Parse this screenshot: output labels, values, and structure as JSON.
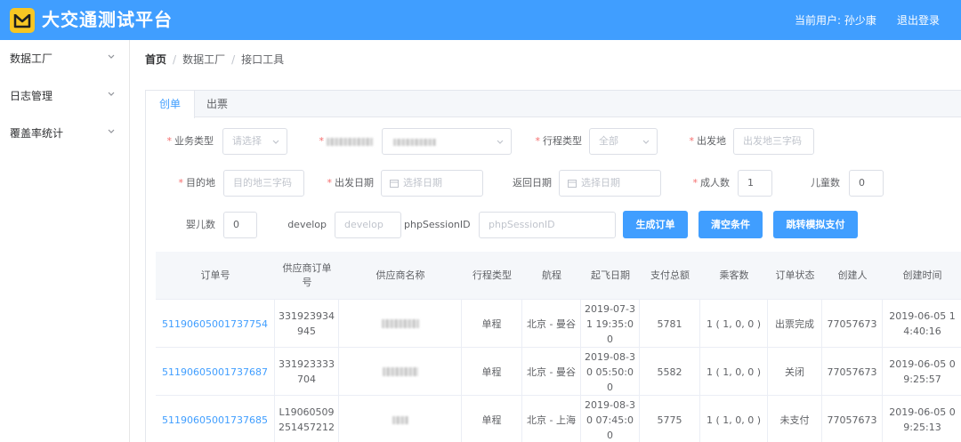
{
  "header": {
    "app_title": "大交通测试平台",
    "current_user": "当前用户: 孙少康",
    "logout": "退出登录",
    "logo_icon": "mail-icon",
    "brand_color": "#409eff",
    "logo_color": "#f7c623"
  },
  "sidebar": {
    "items": [
      {
        "label": "数据工厂"
      },
      {
        "label": "日志管理"
      },
      {
        "label": "覆盖率统计"
      }
    ]
  },
  "breadcrumb": [
    "首页",
    "数据工厂",
    "接口工具"
  ],
  "tabs": [
    {
      "label": "创单"
    },
    {
      "label": "出票"
    }
  ],
  "form": {
    "business_type": {
      "label": "业务类型",
      "placeholder": "请选择"
    },
    "trip_type": {
      "label": "行程类型",
      "value": "全部"
    },
    "departure": {
      "label": "出发地",
      "placeholder": "出发地三字码"
    },
    "destination": {
      "label": "目的地",
      "placeholder": "目的地三字码"
    },
    "depart_date": {
      "label": "出发日期",
      "placeholder": "选择日期"
    },
    "return_date": {
      "label": "返回日期",
      "placeholder": "选择日期"
    },
    "adult_count": {
      "label": "成人数",
      "value": "1"
    },
    "child_count": {
      "label": "儿童数",
      "value": "0"
    },
    "infant_count": {
      "label": "婴儿数",
      "value": "0"
    },
    "develop": {
      "label": "develop",
      "placeholder": "develop"
    },
    "php_session": {
      "label": "phpSessionID",
      "placeholder": "phpSessionID"
    }
  },
  "buttons": {
    "create_order": "生成订单",
    "clear": "清空条件",
    "jump_pay": "跳转模拟支付"
  },
  "table": {
    "columns": [
      "订单号",
      "供应商订单号",
      "供应商名称",
      "行程类型",
      "航程",
      "起飞日期",
      "支付总额",
      "乘客数",
      "订单状态",
      "创建人",
      "创建时间"
    ],
    "rows": [
      [
        "51190605001737754",
        "331923934945",
        "",
        "单程",
        "北京 - 曼谷",
        "2019-07-31 19:35:00",
        "5781",
        "1 ( 1, 0, 0 )",
        "出票完成",
        "77057673",
        "2019-06-05 14:40:16"
      ],
      [
        "51190605001737687",
        "331923333704",
        "",
        "单程",
        "北京 - 曼谷",
        "2019-08-30 05:50:00",
        "5582",
        "1 ( 1, 0, 0 )",
        "关闭",
        "77057673",
        "2019-06-05 09:25:57"
      ],
      [
        "51190605001737685",
        "L19060509251457212",
        "",
        "单程",
        "北京 - 上海",
        "2019-08-30 07:45:00",
        "5775",
        "1 ( 1, 0, 0 )",
        "未支付",
        "77057673",
        "2019-06-05 09:25:13"
      ]
    ]
  }
}
